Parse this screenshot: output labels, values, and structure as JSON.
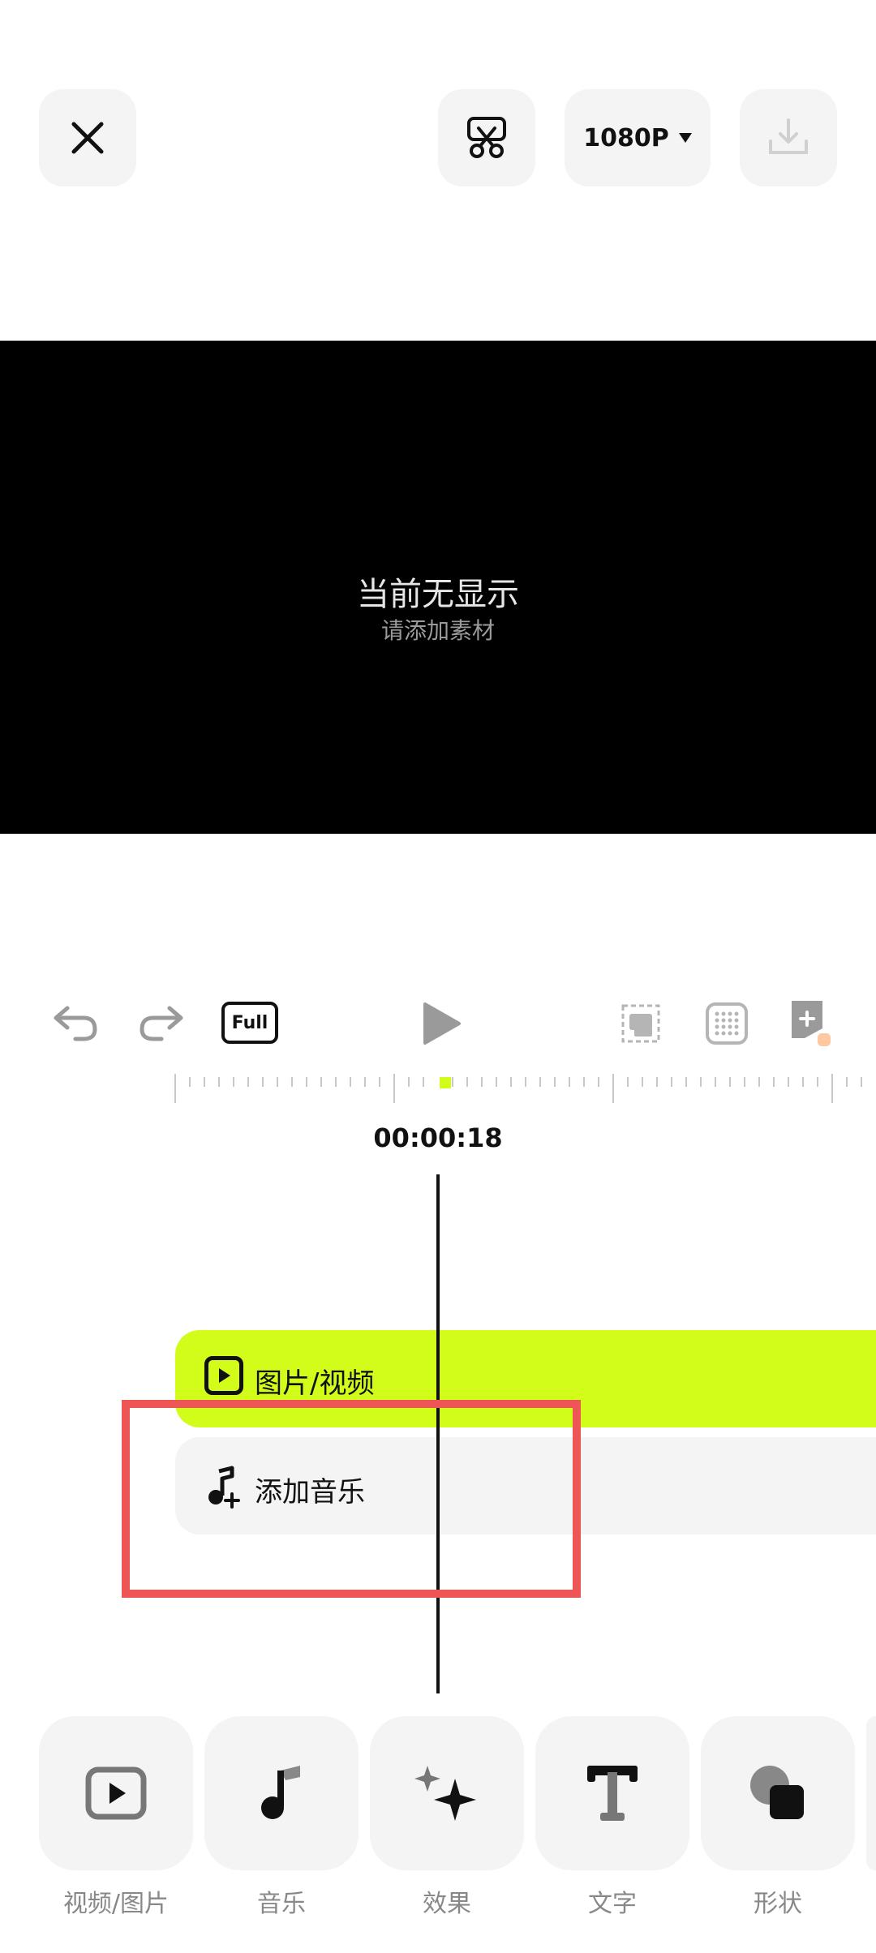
{
  "topbar": {
    "resolution": "1080P"
  },
  "preview": {
    "title": "当前无显示",
    "subtitle": "请添加素材"
  },
  "toolbar": {
    "full_label": "Full"
  },
  "timeline": {
    "timecode": "00:00:18",
    "tracks": {
      "video_label": "图片/视频",
      "audio_label": "添加音乐"
    },
    "highlight_color": "#ee5656",
    "video_track_color": "#d2fd1b"
  },
  "bottom_tabs": [
    {
      "label": "视频/图片",
      "icon": "video-icon"
    },
    {
      "label": "音乐",
      "icon": "music-icon"
    },
    {
      "label": "效果",
      "icon": "sparkle-icon"
    },
    {
      "label": "文字",
      "icon": "text-icon"
    },
    {
      "label": "形状",
      "icon": "shape-icon"
    }
  ]
}
